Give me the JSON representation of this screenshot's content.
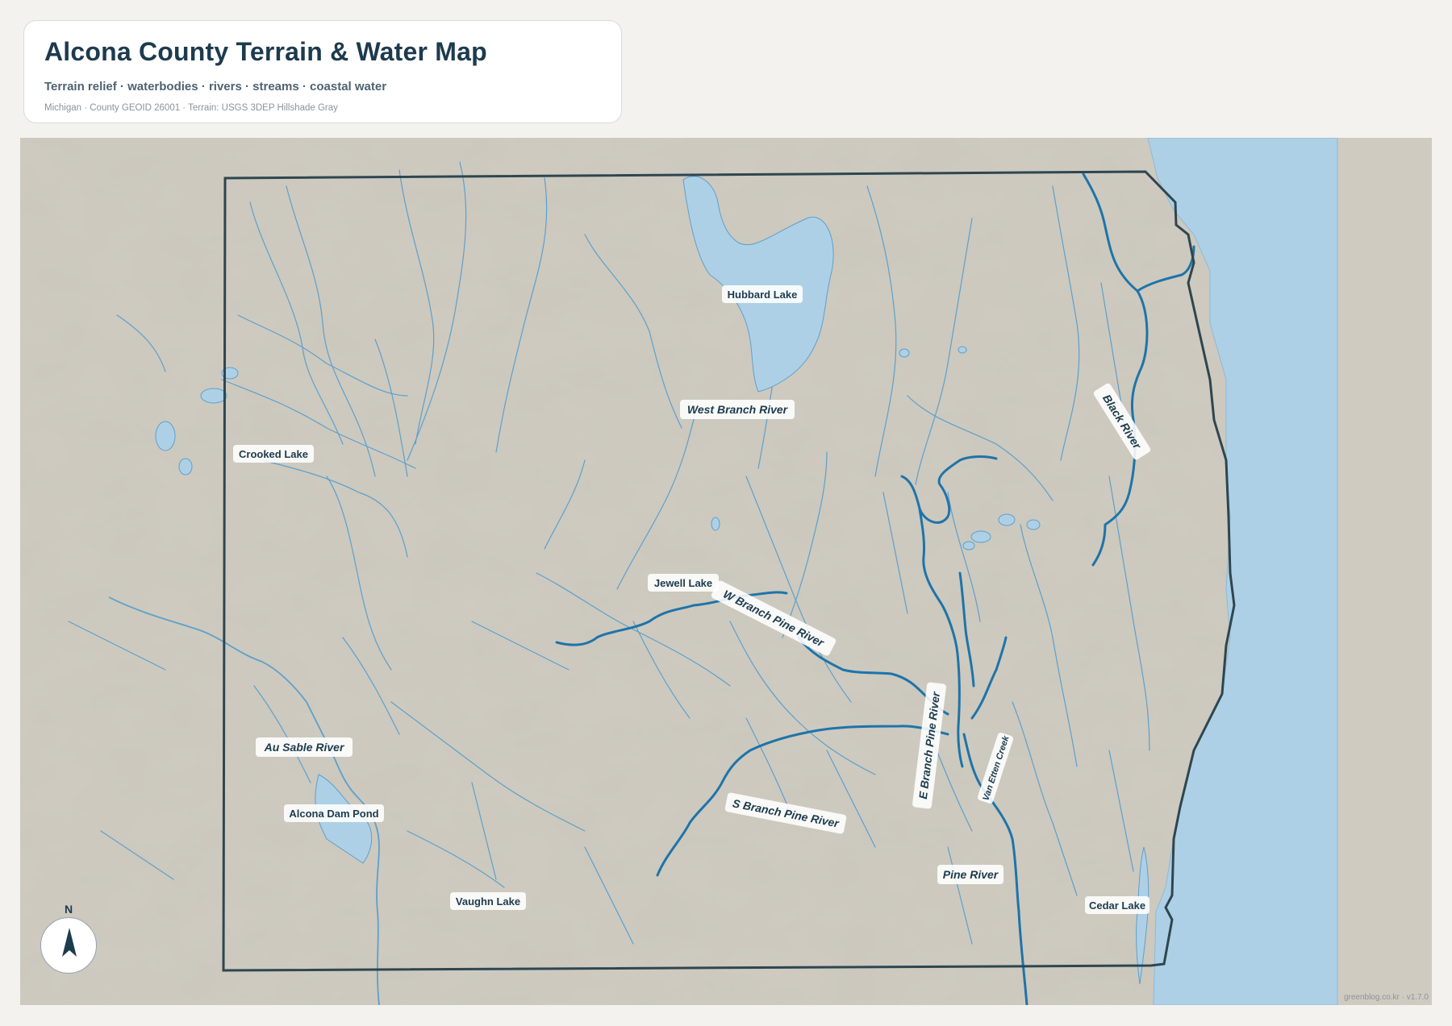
{
  "header": {
    "title": "Alcona County Terrain & Water Map",
    "subtitle": "Terrain relief · waterbodies · rivers · streams · coastal water",
    "meta": "Michigan · County GEOID 26001 · Terrain: USGS 3DEP Hillshade Gray"
  },
  "map": {
    "colors": {
      "land": "#cfcbc0",
      "water": "#aed0e6",
      "coast": "#b6d1e2",
      "river": "#1e74a9",
      "stream": "#5da0cb",
      "boundary": "#2e4650"
    },
    "labels": {
      "hubbard_lake": "Hubbard Lake",
      "west_branch_river": "West Branch River",
      "black_river": "Black River",
      "crooked_lake": "Crooked Lake",
      "jewell_lake": "Jewell Lake",
      "w_branch_pine_river": "W Branch Pine River",
      "e_branch_pine_river": "E Branch Pine River",
      "van_etten_creek": "Van Etten Creek",
      "s_branch_pine_river": "S Branch Pine River",
      "au_sable_river": "Au Sable River",
      "alcona_dam_pond": "Alcona Dam Pond",
      "vaughn_lake": "Vaughn Lake",
      "pine_river": "Pine River",
      "cedar_lake": "Cedar Lake"
    }
  },
  "north_arrow": {
    "letter": "N",
    "icon": "north-arrow-icon"
  },
  "credit": "greenblog.co.kr · v1.7.0"
}
